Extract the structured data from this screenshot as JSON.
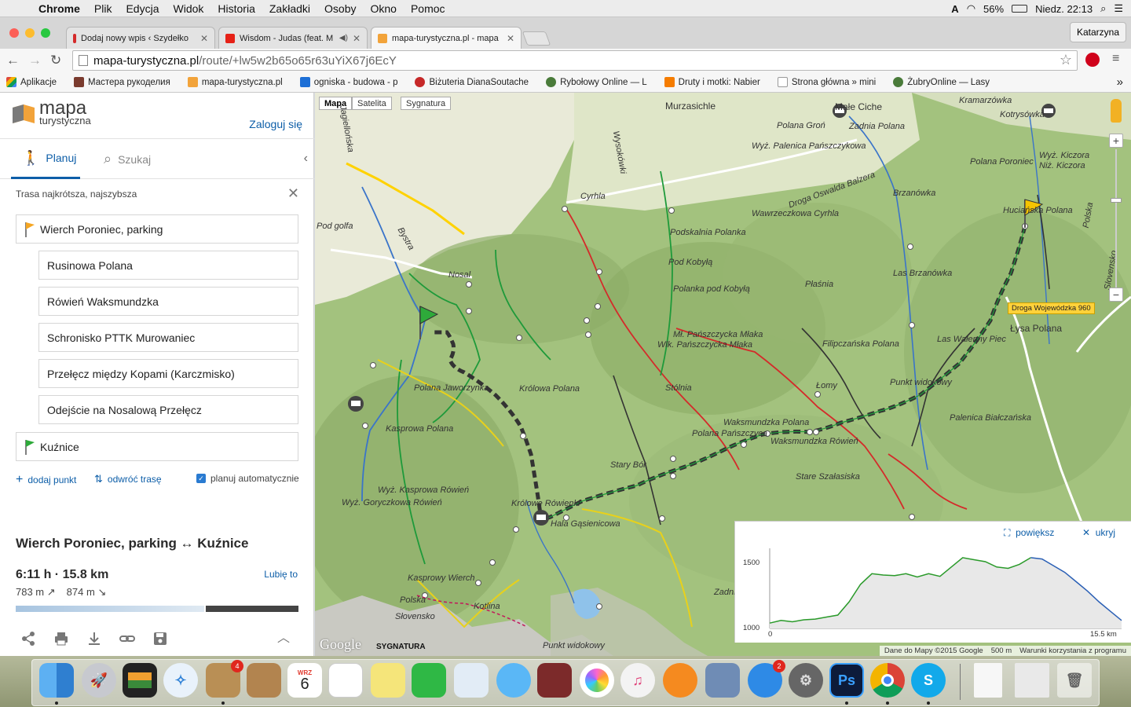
{
  "menubar": {
    "app": "Chrome",
    "items": [
      "Plik",
      "Edycja",
      "Widok",
      "Historia",
      "Zakładki",
      "Osoby",
      "Okno",
      "Pomoc"
    ],
    "battery": "56%",
    "clock": "Niedz. 22:13"
  },
  "tabs": [
    {
      "label": "Dodaj nowy wpis ‹ Szydełko",
      "color": "#d42a2a"
    },
    {
      "label": "Wisdom - Judas (feat. M",
      "color": "#e62117"
    },
    {
      "label": "mapa-turystyczna.pl - mapa",
      "color": "#f2a33a"
    }
  ],
  "profile": "Katarzyna",
  "url": {
    "host": "mapa-turystyczna.pl",
    "path": "/route/+lw5w2b65o65r63uYiX67j6EcY"
  },
  "bookmarks": [
    {
      "label": "Aplikacje",
      "color": "#e04a3a"
    },
    {
      "label": "Мастера рукоделия",
      "color": "#7a3b2e"
    },
    {
      "label": "mapa-turystyczna.pl",
      "color": "#f2a33a"
    },
    {
      "label": "ogniska - budowa - p",
      "color": "#1d6fd6"
    },
    {
      "label": "Biżuteria DianaSoutache",
      "color": "#c62828"
    },
    {
      "label": "Rybołowy Online — L",
      "color": "#4a7b3a"
    },
    {
      "label": "Druty i motki: Nabier",
      "color": "#f57c00"
    },
    {
      "label": "Strona główna » mini",
      "color": "#999999"
    },
    {
      "label": "ŻubryOnline — Lasy",
      "color": "#4a7b3a"
    }
  ],
  "sidebar": {
    "logo_line1": "mapa",
    "logo_line2": "turystyczna",
    "login": "Zaloguj się",
    "tab_plan": "Planuj",
    "tab_search": "Szukaj",
    "route_type": "Trasa najkrótsza, najszybsza",
    "start": "Wierch Poroniec, parking",
    "via": [
      "Rusinowa Polana",
      "Rówień Waksmundzka",
      "Schronisko PTTK Murowaniec",
      "Przełęcz między Kopami (Karczmisko)",
      "Odejście na Nosalową Przełęcz"
    ],
    "end": "Kuźnice",
    "add_point": "dodaj punkt",
    "reverse": "odwróć trasę",
    "auto": "planuj automatycznie",
    "summary_title": "Wierch Poroniec, parking ↔ Kuźnice",
    "summary_time": "6:11 h · 15.8 km",
    "like": "Lubię to",
    "ascent": "783 m",
    "descent": "874 m"
  },
  "map": {
    "types": [
      "Mapa",
      "Satelita",
      "Sygnatura"
    ],
    "places": [
      "Murzasichle",
      "Małe Ciche",
      "Polana Groń",
      "Zadnia Polana",
      "Kramarzówka",
      "Kotrysówka",
      "Wyż. Palenica Pańszczykowa",
      "Droga Oswalda Balzera",
      "Brzanówka",
      "Polana Poroniec",
      "Wyż. Kiczora",
      "Niż. Kiczora",
      "Cyrhla",
      "Wawrzeczkowa Cyrhla",
      "Huciańska Polana",
      "Podskalnia Polanka",
      "Pod Kobyłą",
      "Polanka pod Kobyłą",
      "Płaśnia",
      "Las Brzanówka",
      "Nosal",
      "Wlk. Pańszczycka Młaka",
      "Mł. Pańszczycka Młaka",
      "Filipczańska Polana",
      "Las Wałenny Piec",
      "Polana Jaworzynka",
      "Królowa Polana",
      "Stólnia",
      "Łomy",
      "Punkt widokowy",
      "Kasprowa Polana",
      "Waksmundzka Polana",
      "Polana Pańszczyca",
      "Waksmundzka Rówień",
      "Palenica Białczańska",
      "Stary Bór",
      "Stare Szałasiska",
      "Wyż. Kasprowa Rówień",
      "Wyż. Goryczkowa Rówień",
      "Królowe Rówienki",
      "Hala Gąsienicowa",
      "Kasprowy Wierch",
      "Polska",
      "Słovensko",
      "Kotlina",
      "Łysa Polana",
      "Bystra",
      "Jagiellońska",
      "Wysokówki",
      "Polska",
      "Slovensko",
      "Zadni",
      "Punkt widokowy",
      "Pod golfa"
    ],
    "road_label": "Droga Wojewódzka 960",
    "zoom_in": "+",
    "zoom_out": "−",
    "google": "Google",
    "sygnatura": "SYGNATURA",
    "attribution": "Dane do Mapy ©2015 Google",
    "scale": "500 m",
    "terms": "Warunki korzystania z programu"
  },
  "elevation": {
    "enlarge": "powiększ",
    "hide": "ukryj",
    "y_labels": [
      "1500",
      "1000"
    ],
    "x_start": "0",
    "x_end": "15.5 km",
    "ylim": [
      1000,
      1600
    ],
    "km": [
      0,
      0.5,
      1,
      1.5,
      2,
      2.5,
      3,
      3.5,
      4,
      4.5,
      5,
      5.5,
      6,
      6.5,
      7,
      7.5,
      8,
      8.5,
      9,
      9.5,
      10,
      10.5,
      11,
      11.5,
      12,
      12.5,
      13,
      13.5,
      14,
      14.5,
      15,
      15.5
    ],
    "elev": [
      1040,
      1060,
      1050,
      1065,
      1070,
      1085,
      1100,
      1200,
      1330,
      1410,
      1400,
      1395,
      1410,
      1385,
      1410,
      1390,
      1460,
      1530,
      1515,
      1500,
      1460,
      1450,
      1480,
      1530,
      1520,
      1470,
      1420,
      1350,
      1280,
      1200,
      1130,
      1060
    ]
  },
  "dock": {
    "calendar_month": "WRZ",
    "calendar_day": "6",
    "mail_badge": "4",
    "appstore_badge": "2",
    "ps": "Ps"
  }
}
